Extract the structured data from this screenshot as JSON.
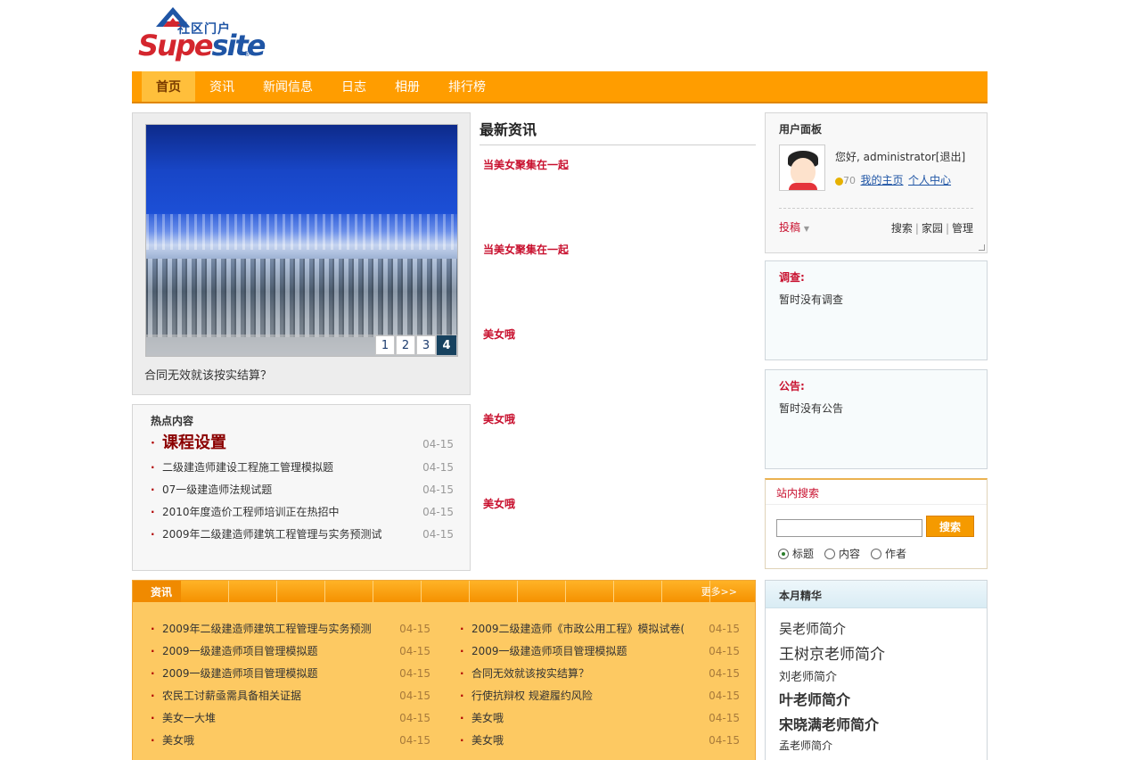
{
  "logo": {
    "cn": "社区门户",
    "en_a": "Supe",
    "en_b": "site",
    "reg": "®"
  },
  "nav": {
    "items": [
      "首页",
      "资讯",
      "新闻信息",
      "日志",
      "相册",
      "排行榜"
    ]
  },
  "slideshow": {
    "pages": [
      "1",
      "2",
      "3",
      "4"
    ],
    "active_page": "4",
    "caption": "合同无效就该按实结算？"
  },
  "hot": {
    "title": "热点内容",
    "items": [
      {
        "title": "课程设置",
        "date": "04-15"
      },
      {
        "title": "二级建造师建设工程施工管理模拟题",
        "date": "04-15"
      },
      {
        "title": "07一级建造师法规试题",
        "date": "04-15"
      },
      {
        "title": "2010年度造价工程师培训正在热招中",
        "date": "04-15"
      },
      {
        "title": "2009年二级建造师建筑工程管理与实务预测试",
        "date": "04-15"
      }
    ]
  },
  "latest": {
    "title": "最新资讯",
    "items": [
      "当美女聚集在一起",
      "当美女聚集在一起",
      "美女哦",
      "美女哦",
      "美女哦"
    ]
  },
  "user_panel": {
    "title": "用户面板",
    "greeting": "您好, administrator[退出]",
    "credits": "70",
    "my_home": "我的主页",
    "personal_center": "个人中心",
    "submit": "投稿",
    "links": [
      "搜索",
      "家园",
      "管理"
    ]
  },
  "survey": {
    "title": "调查:",
    "text": "暂时没有调查"
  },
  "notice": {
    "title": "公告:",
    "text": "暂时没有公告"
  },
  "search": {
    "title": "站内搜索",
    "button": "搜索",
    "input_value": "",
    "options": [
      "标题",
      "内容",
      "作者"
    ],
    "selected": "标题"
  },
  "picks": {
    "title": "本月精华",
    "items": [
      "吴老师简介",
      "王树京老师简介",
      "刘老师简介",
      "叶老师简介",
      "宋晓满老师简介",
      "孟老师简介"
    ]
  },
  "news": {
    "title": "资讯",
    "more": "更多>>",
    "left": [
      {
        "title": "2009年二级建造师建筑工程管理与实务预测",
        "date": "04-15"
      },
      {
        "title": "2009一级建造师项目管理模拟题",
        "date": "04-15"
      },
      {
        "title": "2009一级建造师项目管理模拟题",
        "date": "04-15"
      },
      {
        "title": "农民工讨薪亟需具备相关证据",
        "date": "04-15"
      },
      {
        "title": "美女一大堆",
        "date": "04-15"
      },
      {
        "title": "美女哦",
        "date": "04-15"
      }
    ],
    "right": [
      {
        "title": "2009二级建造师《市政公用工程》模拟试卷(",
        "date": "04-15"
      },
      {
        "title": "2009一级建造师项目管理模拟题",
        "date": "04-15"
      },
      {
        "title": "合同无效就该按实结算？",
        "date": "04-15"
      },
      {
        "title": "行使抗辩权 规避履约风险",
        "date": "04-15"
      },
      {
        "title": "美女哦",
        "date": "04-15"
      },
      {
        "title": "美女哦",
        "date": "04-15"
      }
    ]
  }
}
